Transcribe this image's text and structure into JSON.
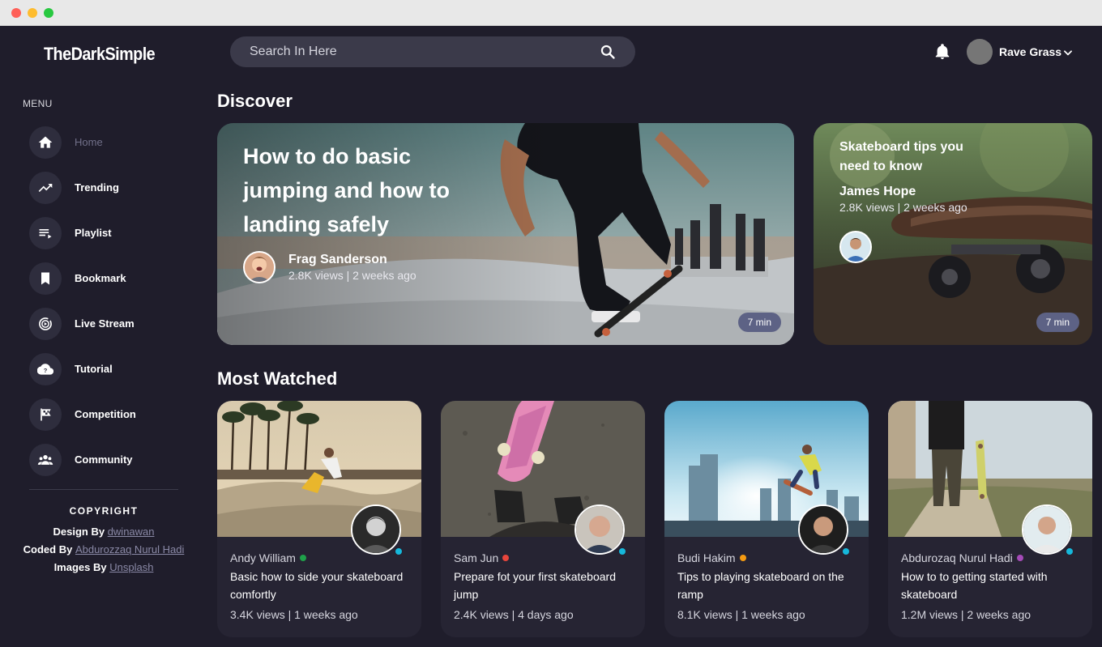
{
  "brand": {
    "logo": "TheDarkSimple"
  },
  "search": {
    "placeholder": "Search In Here"
  },
  "user": {
    "name": "Rave Grass"
  },
  "sidebar": {
    "menu_heading": "MENU",
    "items": [
      {
        "label": "Home",
        "icon": "home-icon",
        "active": true
      },
      {
        "label": "Trending",
        "icon": "trending-icon"
      },
      {
        "label": "Playlist",
        "icon": "playlist-icon"
      },
      {
        "label": "Bookmark",
        "icon": "bookmark-icon"
      },
      {
        "label": "Live Stream",
        "icon": "live-stream-icon"
      },
      {
        "label": "Tutorial",
        "icon": "tutorial-icon"
      },
      {
        "label": "Competition",
        "icon": "flag-icon"
      },
      {
        "label": "Community",
        "icon": "community-icon"
      }
    ],
    "copyright": {
      "heading": "COPYRIGHT",
      "design_prefix": "Design By",
      "design_link": "dwinawan",
      "coded_prefix": "Coded By",
      "coded_link": "Abdurozzaq Nurul Hadi",
      "images_prefix": "Images By",
      "images_link": "Unsplash"
    }
  },
  "discover": {
    "heading": "Discover",
    "featured": [
      {
        "title": "How to do basic jumping and how to landing safely",
        "author": "Frag Sanderson",
        "meta": "2.8K views | 2 weeks ago",
        "duration": "7 min"
      },
      {
        "title": "Skateboard tips you need to know",
        "author": "James Hope",
        "meta": "2.8K views | 2 weeks ago",
        "duration": "7 min"
      }
    ]
  },
  "most_watched": {
    "heading": "Most Watched",
    "videos": [
      {
        "author": "Andy William",
        "status_color": "#1fa14a",
        "title": "Basic how to side your skateboard comfortly",
        "meta": "3.4K views | 1 weeks ago"
      },
      {
        "author": "Sam Jun",
        "status_color": "#e8453c",
        "title": "Prepare fot your first skateboard jump",
        "meta": "2.4K views | 4 days ago"
      },
      {
        "author": "Budi Hakim",
        "status_color": "#f59b12",
        "title": "Tips to playing skateboard on the ramp",
        "meta": "8.1K views | 1 weeks ago"
      },
      {
        "author": "Abdurozaq Nurul Hadi",
        "status_color": "#a54bb8",
        "title": "How to to getting started with skateboard",
        "meta": "1.2M views | 2 weeks ago"
      }
    ]
  }
}
